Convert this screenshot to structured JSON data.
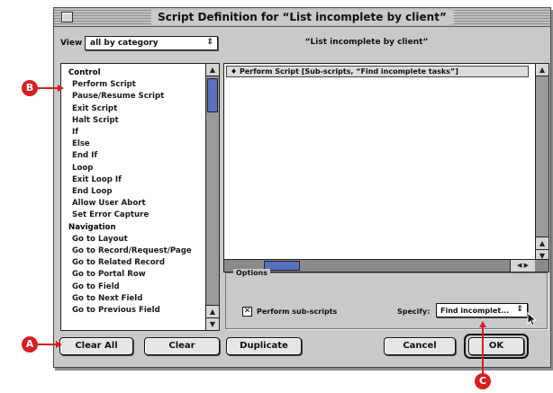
{
  "window": {
    "title": "Script Definition for “List incomplete by client”"
  },
  "view": {
    "label": "View",
    "selected": "all by category"
  },
  "script_name": "“List incomplete by client”",
  "steps": [
    {
      "text": "Control",
      "kind": "cat"
    },
    {
      "text": "Perform Script",
      "kind": "item"
    },
    {
      "text": "Pause/Resume Script",
      "kind": "item"
    },
    {
      "text": "Exit Script",
      "kind": "item"
    },
    {
      "text": "Halt Script",
      "kind": "item"
    },
    {
      "text": "If",
      "kind": "item"
    },
    {
      "text": "Else",
      "kind": "item"
    },
    {
      "text": "End If",
      "kind": "item"
    },
    {
      "text": "Loop",
      "kind": "item"
    },
    {
      "text": "Exit Loop If",
      "kind": "item"
    },
    {
      "text": "End Loop",
      "kind": "item"
    },
    {
      "text": "Allow User Abort",
      "kind": "item"
    },
    {
      "text": "Set Error Capture",
      "kind": "item"
    },
    {
      "text": "Navigation",
      "kind": "cat"
    },
    {
      "text": "Go to Layout",
      "kind": "item"
    },
    {
      "text": "Go to Record/Request/Page",
      "kind": "item"
    },
    {
      "text": "Go to Related Record",
      "kind": "item"
    },
    {
      "text": "Go to Portal Row",
      "kind": "item"
    },
    {
      "text": "Go to Field",
      "kind": "item"
    },
    {
      "text": "Go to Next Field",
      "kind": "item"
    },
    {
      "text": "Go to Previous Field",
      "kind": "item"
    }
  ],
  "script_steps": [
    "♦  Perform Script [Sub-scripts, “Find incomplete tasks”]"
  ],
  "options": {
    "label": "Options",
    "checkbox_label": "Perform sub-scripts",
    "checkbox_mark": "✕",
    "checked": true,
    "specify_label": "Specify:",
    "specify_value": "Find incomplet..."
  },
  "buttons": {
    "clear_all": "Clear All",
    "clear": "Clear",
    "duplicate": "Duplicate",
    "cancel": "Cancel",
    "ok": "OK"
  },
  "callouts": {
    "a": "A",
    "b": "B",
    "c": "C"
  },
  "colors": {
    "callout": "#d62020",
    "scroll_thumb": "#5a6fc0",
    "dialog_bg": "#c9c9c9"
  }
}
